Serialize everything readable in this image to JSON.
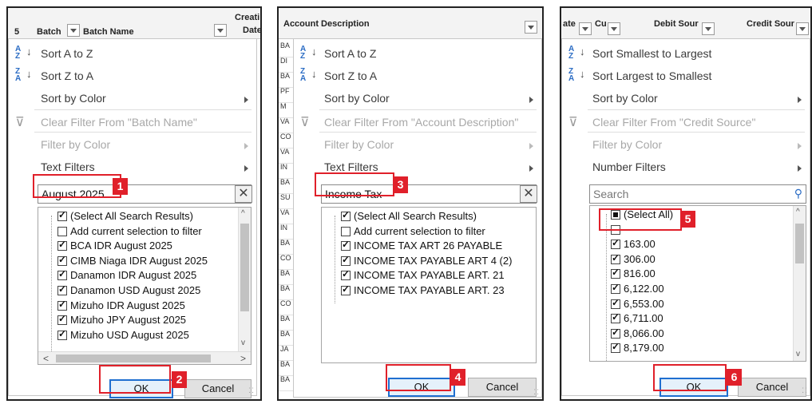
{
  "panel1": {
    "header": {
      "row_num": "5",
      "col1": "Batch",
      "col2": "Batch Name",
      "col3_line1": "Creati",
      "col3_line2": "Date"
    },
    "menu": {
      "sort_asc": "Sort A to Z",
      "sort_desc": "Sort Z to A",
      "sort_color": "Sort by Color",
      "clear_filter": "Clear Filter From \"Batch Name\"",
      "filter_color": "Filter by Color",
      "text_filters": "Text Filters"
    },
    "search_value": "August 2025",
    "items": [
      {
        "label": "(Select All Search Results)",
        "checked": true
      },
      {
        "label": "Add current selection to filter",
        "checked": false
      },
      {
        "label": "BCA IDR August 2025",
        "checked": true
      },
      {
        "label": "CIMB Niaga IDR August 2025",
        "checked": true
      },
      {
        "label": "Danamon IDR August 2025",
        "checked": true
      },
      {
        "label": "Danamon USD August 2025",
        "checked": true
      },
      {
        "label": "Mizuho IDR August 2025",
        "checked": true
      },
      {
        "label": "Mizuho JPY August 2025",
        "checked": true
      },
      {
        "label": "Mizuho USD August 2025",
        "checked": true
      }
    ],
    "ok_label": "OK",
    "cancel_label": "Cancel",
    "step_search": "1",
    "step_ok": "2"
  },
  "panel2": {
    "header": {
      "col1": "Account Description"
    },
    "row_stubs": [
      "BA",
      "DI",
      "BA",
      "PF",
      "M",
      "VA",
      "CO",
      "VA",
      "IN",
      "BA",
      "SU",
      "VA",
      "IN",
      "BA",
      "CO",
      "BA",
      "BA",
      "CO",
      "BA",
      "BA",
      "JA",
      "BA",
      "BA"
    ],
    "menu": {
      "sort_asc": "Sort A to Z",
      "sort_desc": "Sort Z to A",
      "sort_color": "Sort by Color",
      "clear_filter": "Clear Filter From \"Account Description\"",
      "filter_color": "Filter by Color",
      "text_filters": "Text Filters"
    },
    "search_value": "Income Tax",
    "items": [
      {
        "label": "(Select All Search Results)",
        "checked": true
      },
      {
        "label": "Add current selection to filter",
        "checked": false
      },
      {
        "label": "INCOME TAX ART 26 PAYABLE",
        "checked": true
      },
      {
        "label": "INCOME TAX PAYABLE ART 4 (2)",
        "checked": true
      },
      {
        "label": "INCOME TAX PAYABLE ART. 21",
        "checked": true
      },
      {
        "label": "INCOME TAX PAYABLE ART. 23",
        "checked": true
      }
    ],
    "ok_label": "OK",
    "cancel_label": "Cancel",
    "step_search": "3",
    "step_ok": "4"
  },
  "panel3": {
    "header": {
      "col1": "ate",
      "col2": "Cu",
      "col3": "Debit Sour",
      "col4": "Credit Sour"
    },
    "menu": {
      "sort_asc": "Sort Smallest to Largest",
      "sort_desc": "Sort Largest to Smallest",
      "sort_color": "Sort by Color",
      "clear_filter": "Clear Filter From \"Credit Source\"",
      "filter_color": "Filter by Color",
      "number_filters": "Number Filters"
    },
    "search_placeholder": "Search",
    "items": [
      {
        "label": "(Select All)",
        "checked": "partial"
      },
      {
        "label": "-",
        "checked": false
      },
      {
        "label": "163.00",
        "checked": true
      },
      {
        "label": "306.00",
        "checked": true
      },
      {
        "label": "816.00",
        "checked": true
      },
      {
        "label": "6,122.00",
        "checked": true
      },
      {
        "label": "6,553.00",
        "checked": true
      },
      {
        "label": "6,711.00",
        "checked": true
      },
      {
        "label": "8,066.00",
        "checked": true
      },
      {
        "label": "8,179.00",
        "checked": true
      }
    ],
    "ok_label": "OK",
    "cancel_label": "Cancel",
    "step_uncheck": "5",
    "step_ok": "6"
  },
  "colors": {
    "annotation_red": "#e0202a",
    "ok_focus_blue": "#1f6fd0",
    "sort_icon_blue": "#2b6cc4"
  },
  "icons": {
    "sort_asc": "sort-ascending-icon",
    "sort_desc": "sort-descending-icon",
    "clear_filter": "clear-filter-icon",
    "search": "magnifier-icon",
    "clear_search": "close-x-icon"
  }
}
